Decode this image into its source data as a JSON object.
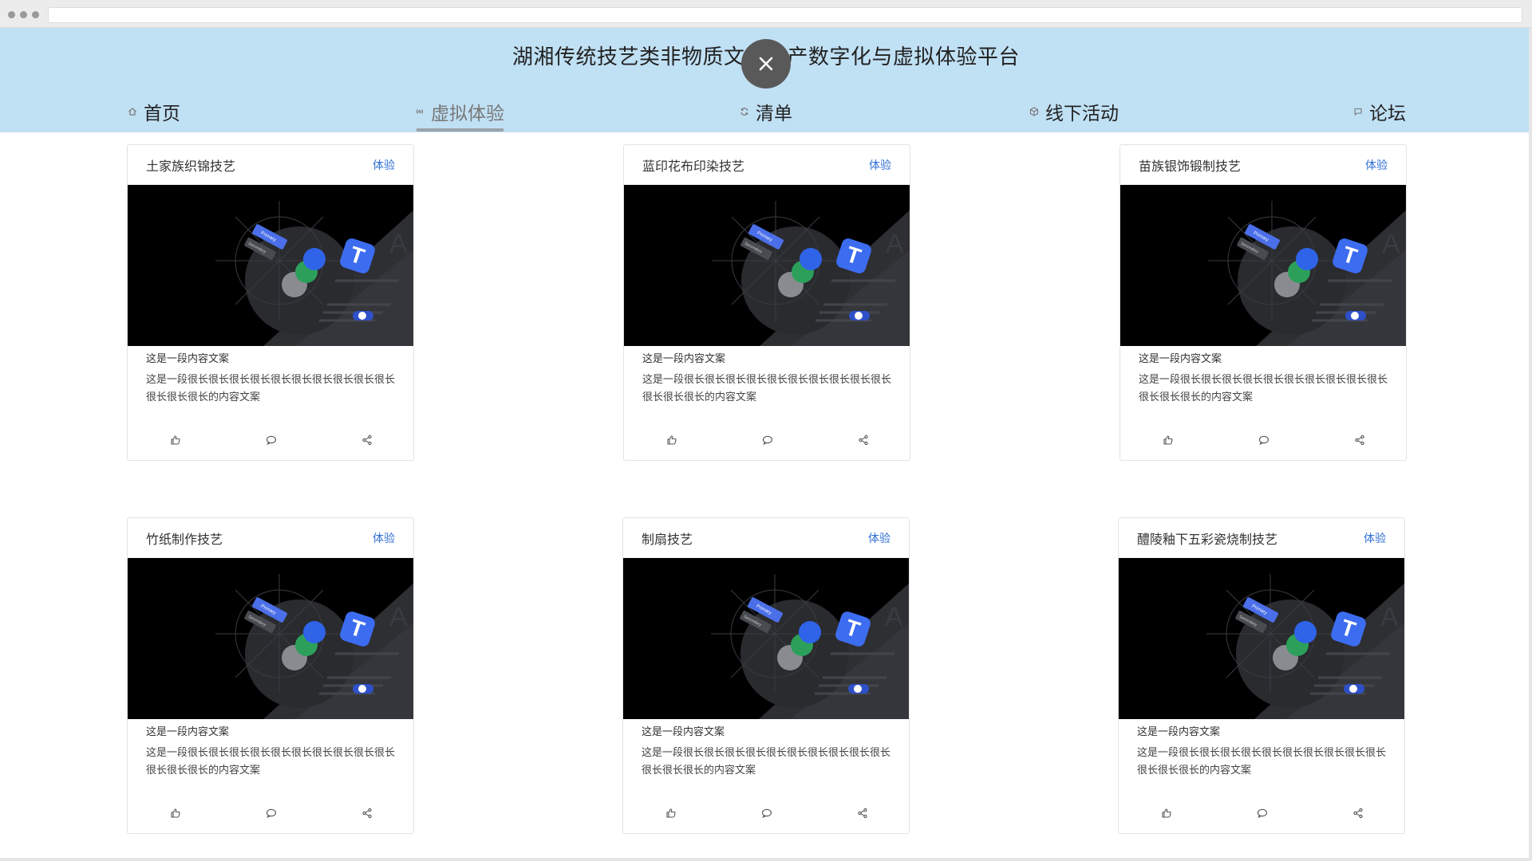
{
  "site": {
    "title": "湖湘传统技艺类非物质文化遗产数字化与虚拟体验平台"
  },
  "nav": {
    "items": [
      {
        "label": "首页",
        "icon": "home-icon",
        "active": false
      },
      {
        "label": "虚拟体验",
        "icon": "signal-icon",
        "active": true
      },
      {
        "label": "清单",
        "icon": "refresh-icon",
        "active": false
      },
      {
        "label": "线下活动",
        "icon": "cube-icon",
        "active": false
      },
      {
        "label": "论坛",
        "icon": "chat-icon",
        "active": false
      }
    ]
  },
  "cards": [
    {
      "title": "土家族织锦技艺",
      "link": "体验",
      "subtitle": "这是一段内容文案",
      "description": "这是一段很长很长很长很长很长很长很长很长很长很长很长很长很长的内容文案"
    },
    {
      "title": "蓝印花布印染技艺",
      "link": "体验",
      "subtitle": "这是一段内容文案",
      "description": "这是一段很长很长很长很长很长很长很长很长很长很长很长很长很长的内容文案"
    },
    {
      "title": "苗族银饰锻制技艺",
      "link": "体验",
      "subtitle": "这是一段内容文案",
      "description": "这是一段很长很长很长很长很长很长很长很长很长很长很长很长很长的内容文案"
    },
    {
      "title": "竹纸制作技艺",
      "link": "体验",
      "subtitle": "这是一段内容文案",
      "description": "这是一段很长很长很长很长很长很长很长很长很长很长很长很长很长的内容文案"
    },
    {
      "title": "制扇技艺",
      "link": "体验",
      "subtitle": "这是一段内容文案",
      "description": "这是一段很长很长很长很长很长很长很长很长很长很长很长很长很长的内容文案"
    },
    {
      "title": "醴陵釉下五彩瓷烧制技艺",
      "link": "体验",
      "subtitle": "这是一段内容文案",
      "description": "这是一段很长很长很长很长很长很长很长很长很长很长很长很长很长的内容文案"
    }
  ],
  "card_image": {
    "labels": {
      "primary": "Primary",
      "secondary": "Secondary",
      "badge": "T"
    }
  },
  "card_actions": [
    "like-icon",
    "comment-icon",
    "share-icon"
  ],
  "colors": {
    "header_bg": "#c0e0f4",
    "link": "#2f6fd6",
    "close_button": "#595959"
  }
}
